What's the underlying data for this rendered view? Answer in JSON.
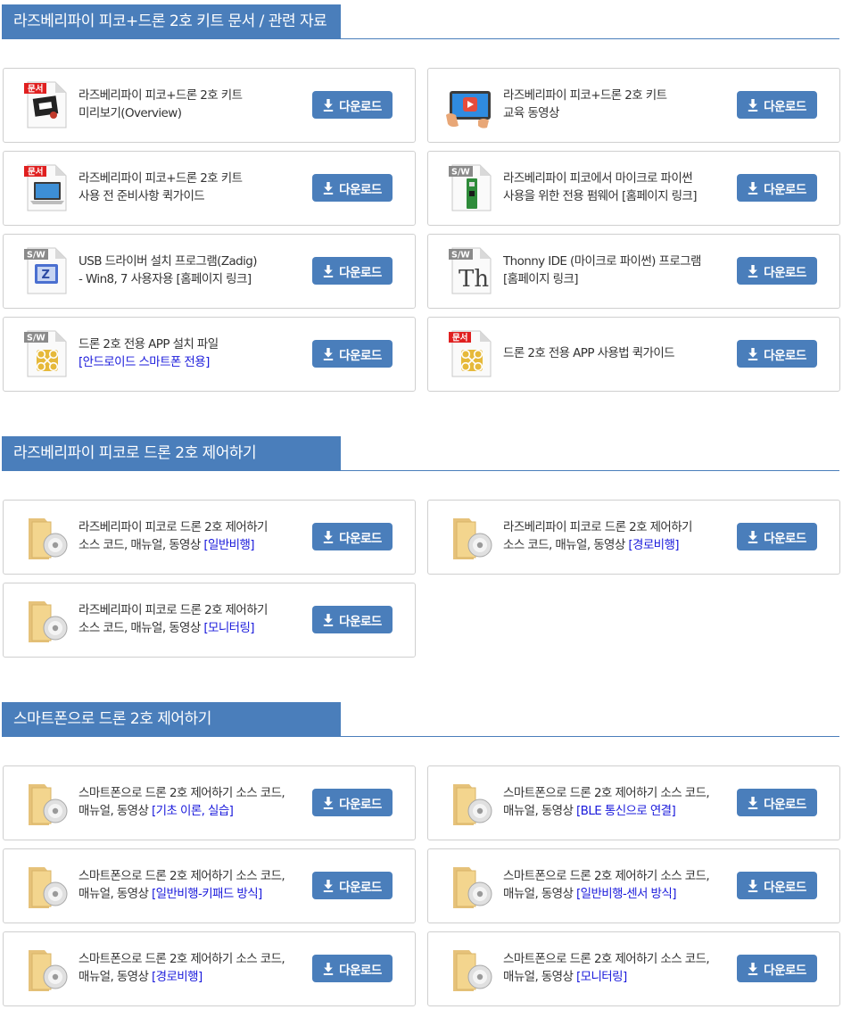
{
  "colors": {
    "accent": "#4a7ebb",
    "highlight": "#1a1adb",
    "doc_badge": "#e02020",
    "sw_badge": "#8a8a8a"
  },
  "download_label": "다운로드",
  "sections": [
    {
      "title": "라즈베리파이 피코+드론 2호 키트 문서 / 관련 자료",
      "items": [
        {
          "icon": "document-booklet-icon",
          "badge": "문서",
          "line1": "라즈베리파이 피코+드론 2호 키트",
          "line2": "미리보기(Overview)",
          "line2_hl": ""
        },
        {
          "icon": "tablet-video-icon",
          "badge": "",
          "line1": "라즈베리파이 피코+드론 2호 키트",
          "line2": "교육 동영상",
          "line2_hl": ""
        },
        {
          "icon": "document-laptop-icon",
          "badge": "문서",
          "line1": "라즈베리파이 피코+드론 2호 키트",
          "line2": "사용 전 준비사항 퀵가이드",
          "line2_hl": ""
        },
        {
          "icon": "software-pico-board-icon",
          "badge": "S/W",
          "line1": "라즈베리파이 피코에서 마이크로 파이썬",
          "line2": "사용을 위한 전용 펌웨어 [홈페이지 링크]",
          "line2_hl": ""
        },
        {
          "icon": "software-zadig-icon",
          "badge": "S/W",
          "line1": "USB 드라이버 설치 프로그램(Zadig)",
          "line2": "- Win8, 7 사용자용 [홈페이지 링크]",
          "line2_hl": ""
        },
        {
          "icon": "software-thonny-icon",
          "badge": "S/W",
          "line1": "Thonny IDE (마이크로 파이썬) 프로그램",
          "line2": "[홈페이지 링크]",
          "line2_hl": ""
        },
        {
          "icon": "software-drone-app-icon",
          "badge": "S/W",
          "line1": "드론 2호 전용 APP 설치 파일",
          "line2": "",
          "line2_hl": "[안드로이드 스마트폰 전용]"
        },
        {
          "icon": "document-drone-app-icon",
          "badge": "문서",
          "line1": "드론 2호 전용 APP 사용법 퀵가이드",
          "line2": "",
          "line2_hl": ""
        }
      ]
    },
    {
      "title": "라즈베리파이 피코로 드론 2호 제어하기",
      "items": [
        {
          "icon": "folder-disc-icon",
          "badge": "",
          "line1": "라즈베리파이 피코로 드론 2호 제어하기",
          "line2": "소스 코드, 매뉴얼, 동영상 ",
          "line2_hl": "[일반비행]"
        },
        {
          "icon": "folder-disc-icon",
          "badge": "",
          "line1": "라즈베리파이 피코로 드론 2호 제어하기",
          "line2": "소스 코드, 매뉴얼, 동영상 ",
          "line2_hl": "[경로비행]"
        },
        {
          "icon": "folder-disc-icon",
          "badge": "",
          "line1": "라즈베리파이 피코로 드론 2호 제어하기",
          "line2": "소스 코드, 매뉴얼, 동영상 ",
          "line2_hl": "[모니터링]"
        }
      ]
    },
    {
      "title": "스마트폰으로 드론 2호 제어하기",
      "items": [
        {
          "icon": "folder-disc-icon",
          "badge": "",
          "line1": "스마트폰으로 드론 2호 제어하기 소스 코드,",
          "line2": "매뉴얼, 동영상 ",
          "line2_hl": "[기초 이론, 실습]"
        },
        {
          "icon": "folder-disc-icon",
          "badge": "",
          "line1": "스마트폰으로 드론 2호 제어하기 소스 코드,",
          "line2": "매뉴얼, 동영상 ",
          "line2_hl": "[BLE 통신으로 연결]"
        },
        {
          "icon": "folder-disc-icon",
          "badge": "",
          "line1": "스마트폰으로 드론 2호 제어하기 소스 코드,",
          "line2": "매뉴얼, 동영상 ",
          "line2_hl": "[일반비행-키패드 방식]"
        },
        {
          "icon": "folder-disc-icon",
          "badge": "",
          "line1": "스마트폰으로 드론 2호 제어하기 소스 코드,",
          "line2": "매뉴얼, 동영상 ",
          "line2_hl": "[일반비행-센서 방식]"
        },
        {
          "icon": "folder-disc-icon",
          "badge": "",
          "line1": "스마트폰으로 드론 2호 제어하기 소스 코드,",
          "line2": "매뉴얼, 동영상 ",
          "line2_hl": "[경로비행]"
        },
        {
          "icon": "folder-disc-icon",
          "badge": "",
          "line1": "스마트폰으로 드론 2호 제어하기 소스 코드,",
          "line2": "매뉴얼, 동영상 ",
          "line2_hl": "[모니터링]"
        }
      ]
    }
  ]
}
